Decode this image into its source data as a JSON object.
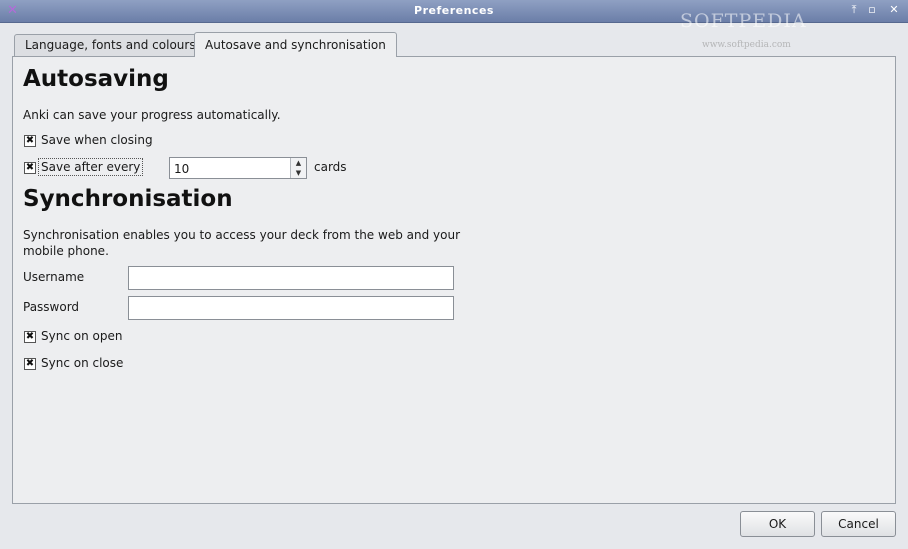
{
  "window": {
    "title": "Preferences",
    "app_icon": "✕",
    "controls": {
      "pin": "⤒",
      "maximize": "▫",
      "close": "✕"
    },
    "watermark": "SOFTPEDIA",
    "watermark_url": "www.softpedia.com"
  },
  "tabs": [
    {
      "label": "Language, fonts and colours",
      "active": false
    },
    {
      "label": "Autosave and synchronisation",
      "active": true
    }
  ],
  "autosaving": {
    "heading": "Autosaving",
    "description": "Anki can save your progress automatically.",
    "save_when_closing": {
      "label": "Save when closing",
      "checked": true
    },
    "save_after_every": {
      "label": "Save after every",
      "checked": true,
      "value": "10",
      "unit": "cards"
    }
  },
  "sync": {
    "heading": "Synchronisation",
    "description_line1": "Synchronisation enables you to access your deck from the web and your",
    "description_line2": "mobile phone.",
    "username_label": "Username",
    "username_value": "",
    "password_label": "Password",
    "password_value": "",
    "sync_on_open": {
      "label": "Sync on open",
      "checked": true
    },
    "sync_on_close": {
      "label": "Sync on close",
      "checked": true
    }
  },
  "buttons": {
    "ok": "OK",
    "cancel": "Cancel"
  },
  "checkmark": "✖"
}
